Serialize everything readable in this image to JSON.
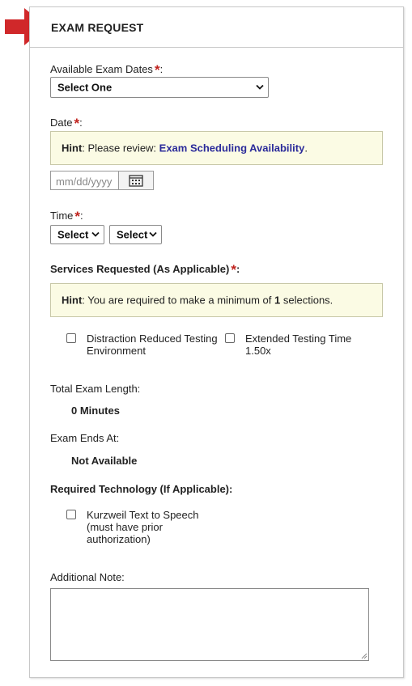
{
  "panel": {
    "title": "EXAM REQUEST"
  },
  "icons": {
    "pointer": "red-arrow-icon",
    "calendar": "calendar-icon",
    "dropdown": "chevron-down-icon",
    "resize": "resize-grip-icon"
  },
  "colors": {
    "required": "#c0231e",
    "arrow": "#d0282a",
    "hint_bg": "#fbfbe4",
    "link": "#2b2b9a"
  },
  "exam_dates": {
    "label": "Available Exam Dates",
    "required_mark": "*",
    "suffix": ":",
    "selected": "Select One"
  },
  "date": {
    "label": "Date",
    "required_mark": "*",
    "suffix": ":",
    "hint_prefix": "Hint",
    "hint_text": ": Please review: ",
    "hint_link": "Exam Scheduling Availability",
    "hint_end": ".",
    "placeholder": "mm/dd/yyyy"
  },
  "time": {
    "label": "Time",
    "required_mark": "*",
    "suffix": ":",
    "hour_selected": "Select",
    "minute_selected": "Select"
  },
  "services": {
    "label": "Services Requested (As Applicable)",
    "required_mark": "*",
    "suffix": ":",
    "hint_prefix": "Hint",
    "hint_text": ": You are required to make a minimum of ",
    "hint_count": "1",
    "hint_end": " selections.",
    "options": [
      {
        "line1": "Distraction Reduced Testing",
        "line2": "Environment",
        "checked": false
      },
      {
        "line1": "Extended Testing Time",
        "line2": "1.50x",
        "checked": false
      }
    ]
  },
  "total_length": {
    "label": "Total Exam Length:",
    "value": "0 Minutes"
  },
  "ends_at": {
    "label": "Exam Ends At:",
    "value": "Not Available"
  },
  "technology": {
    "label": "Required Technology (If Applicable):",
    "options": [
      {
        "line1": "Kurzweil Text to Speech",
        "line2": "(must have prior",
        "line3": "authorization)",
        "checked": false
      }
    ]
  },
  "note": {
    "label": "Additional Note:",
    "value": ""
  }
}
